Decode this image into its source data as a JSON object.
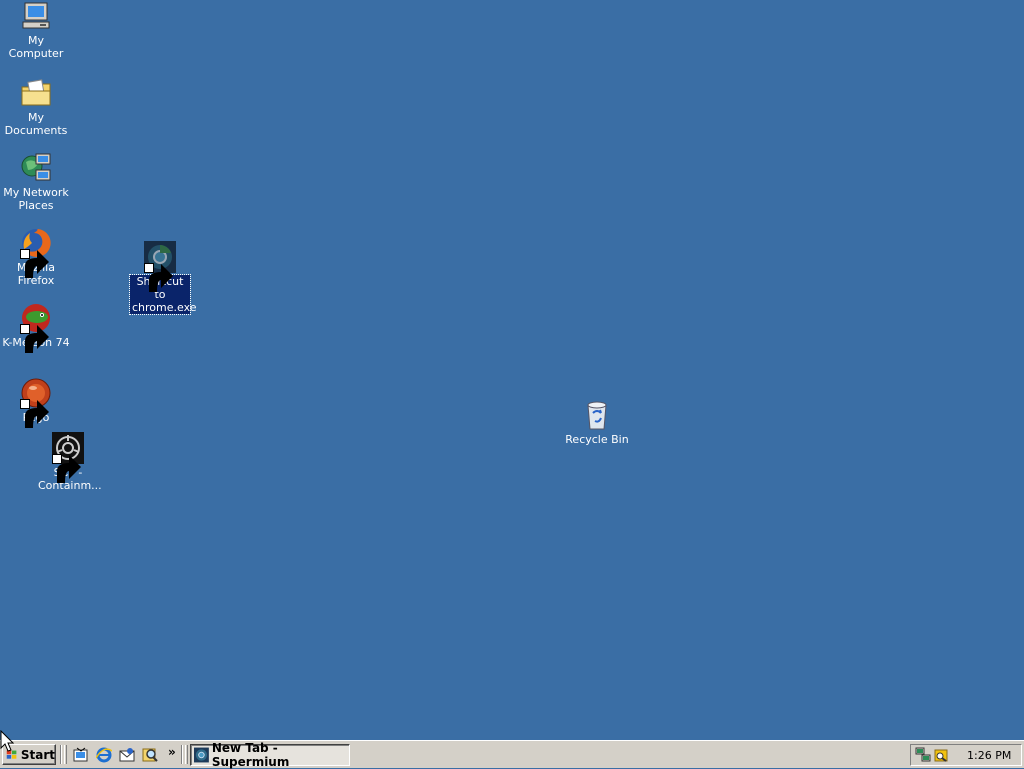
{
  "desktop": {
    "background": "#3a6ea5",
    "icons": [
      {
        "label": "My Computer",
        "icon": "my-computer-icon"
      },
      {
        "label": "My Documents",
        "icon": "my-documents-icon"
      },
      {
        "label": "My Network Places",
        "icon": "my-network-places-icon"
      },
      {
        "label": "Mozilla Firefox",
        "icon": "firefox-icon",
        "shortcut": true
      },
      {
        "label": "K-Meleon 74",
        "icon": "k-meleon-icon",
        "shortcut": true
      },
      {
        "label": "Pego",
        "icon": "pego-icon",
        "shortcut": true
      },
      {
        "label": "SCP - Containm...",
        "icon": "scp-icon",
        "shortcut": true
      },
      {
        "label": "Shortcut to chrome.exe",
        "icon": "chrome-icon",
        "shortcut": true,
        "selected": true
      },
      {
        "label": "Recycle Bin",
        "icon": "recycle-bin-icon"
      }
    ]
  },
  "taskbar": {
    "start_label": "Start",
    "quick_launch": [
      "show-desktop-icon",
      "internet-explorer-icon",
      "outlook-express-icon",
      "search-icon"
    ],
    "quick_launch_more": "»",
    "tasks": [
      {
        "label": "New Tab - Supermium",
        "icon": "supermium-icon",
        "active": true
      }
    ],
    "tray_icons": [
      "network-icon",
      "security-icon"
    ],
    "clock": "1:26 PM"
  }
}
